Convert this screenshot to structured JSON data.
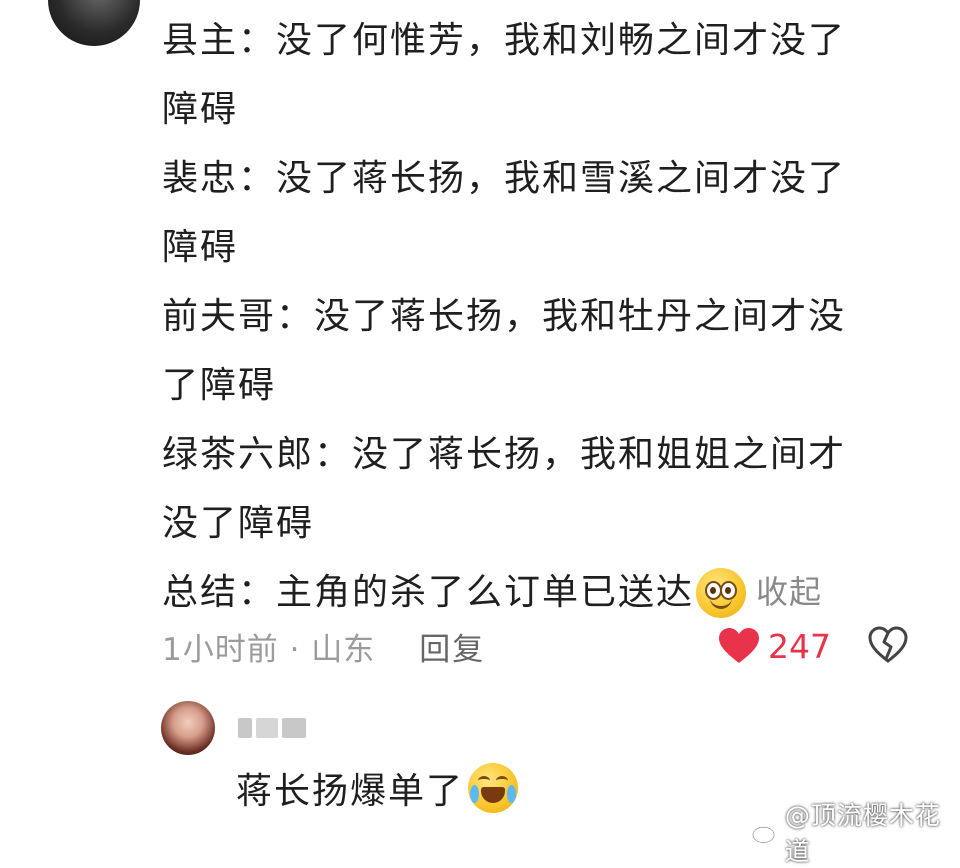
{
  "comment": {
    "lines": [
      "县主：没了何惟芳，我和刘畅之间才没了",
      "障碍",
      "裴忠：没了蒋长扬，我和雪溪之间才没了",
      "障碍",
      "前夫哥：没了蒋长扬，我和牡丹之间才没",
      "了障碍",
      "绿茶六郎：没了蒋长扬，我和姐姐之间才",
      "没了障碍"
    ],
    "summary": "总结：主角的杀了么订单已送达",
    "summary_emoji": "smile-emoji-icon",
    "collapse_label": "收起"
  },
  "meta": {
    "time_location": "1小时前 · 山东",
    "reply_label": "回复",
    "like_count": "247",
    "like_color": "#e8334a"
  },
  "reply": {
    "text": "蒋长扬爆单了",
    "emoji": "laugh-cry-emoji-icon"
  },
  "watermark": {
    "text": "@顶流樱木花道",
    "icon": "weibo-icon"
  }
}
